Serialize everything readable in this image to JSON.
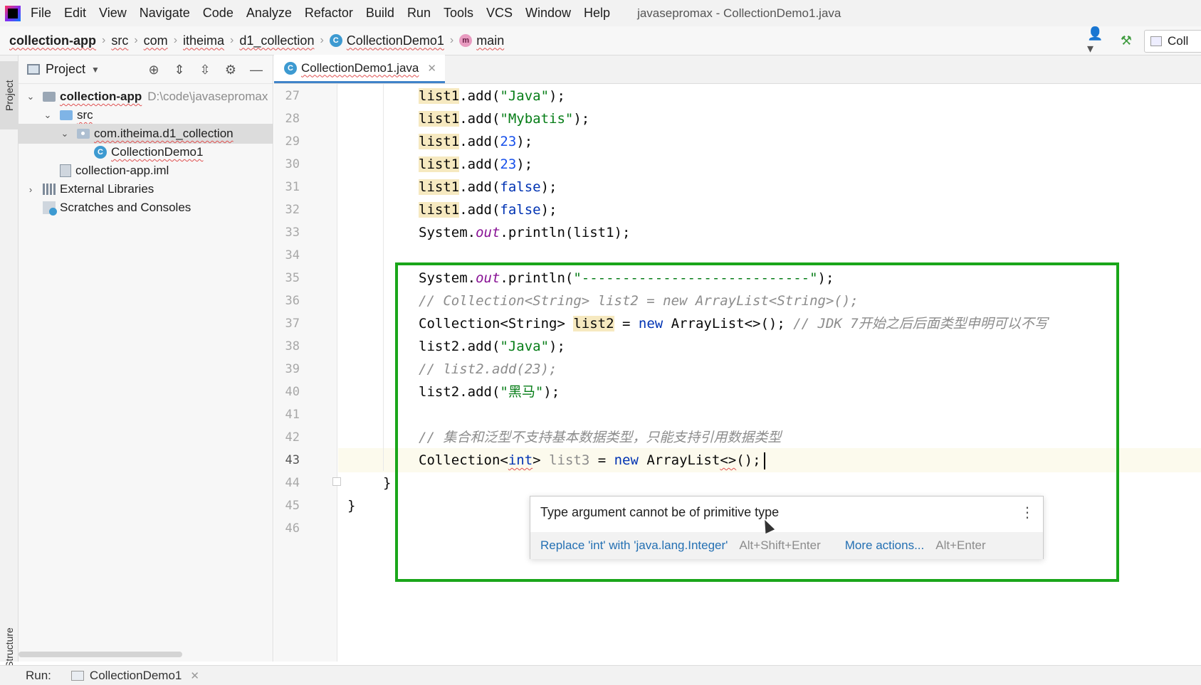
{
  "menubar": {
    "items": [
      "File",
      "Edit",
      "View",
      "Navigate",
      "Code",
      "Analyze",
      "Refactor",
      "Build",
      "Run",
      "Tools",
      "VCS",
      "Window",
      "Help"
    ],
    "window_title": "javasepromax - CollectionDemo1.java"
  },
  "breadcrumbs": [
    "collection-app",
    "src",
    "com",
    "itheima",
    "d1_collection",
    "CollectionDemo1",
    "main"
  ],
  "run_config": {
    "label": "Coll"
  },
  "left_strip": {
    "project_tab": "Project",
    "structure_tab": "Structure"
  },
  "project_panel": {
    "title": "Project",
    "tree": [
      {
        "label": "collection-app",
        "hint": "D:\\code\\javasepromax"
      },
      {
        "label": "src"
      },
      {
        "label": "com.itheima.d1_collection"
      },
      {
        "label": "CollectionDemo1"
      },
      {
        "label": "collection-app.iml"
      },
      {
        "label": "External Libraries"
      },
      {
        "label": "Scratches and Consoles"
      }
    ]
  },
  "editor": {
    "tab_label": "CollectionDemo1.java",
    "line_numbers": [
      "27",
      "28",
      "29",
      "30",
      "31",
      "32",
      "33",
      "34",
      "35",
      "36",
      "37",
      "38",
      "39",
      "40",
      "41",
      "42",
      "43",
      "44",
      "45",
      "46"
    ],
    "code": {
      "l27": {
        "pre": "list1",
        "rest": ".add(",
        "arg": "\"Java\"",
        "end": ");"
      },
      "l28": {
        "pre": "list1",
        "rest": ".add(",
        "arg": "\"Mybatis\"",
        "end": ");"
      },
      "l29": {
        "pre": "list1",
        "rest": ".add(",
        "arg": "23",
        "end": ");"
      },
      "l30": {
        "pre": "list1",
        "rest": ".add(",
        "arg": "23",
        "end": ");"
      },
      "l31": {
        "pre": "list1",
        "rest": ".add(",
        "arg": "false",
        "end": ");"
      },
      "l32": {
        "pre": "list1",
        "rest": ".add(",
        "arg": "false",
        "end": ");"
      },
      "l33": {
        "a": "System.",
        "b": "out",
        "c": ".println(list1);"
      },
      "l35": {
        "a": "System.",
        "b": "out",
        "c": ".println(",
        "d": "\"----------------------------\"",
        "e": ");"
      },
      "l36": "// Collection<String> list2 = new ArrayList<String>();",
      "l37": {
        "a": "Collection<String> ",
        "b": "list2",
        "c": " = ",
        "d": "new",
        "e": " ArrayList<>(); ",
        "f": "// JDK 7开始之后后面类型申明可以不写"
      },
      "l38": {
        "a": "list2.add(",
        "b": "\"Java\"",
        "c": ");"
      },
      "l39": "// list2.add(23);",
      "l40": {
        "a": "list2.add(",
        "b": "\"黑马\"",
        "c": ");"
      },
      "l42": "// 集合和泛型不支持基本数据类型，只能支持引用数据类型",
      "l43": {
        "a": "Collection<",
        "b": "int",
        "c": "> ",
        "d": "list3",
        "e": " = ",
        "f": "new",
        "g": " ArrayList",
        "h": "<>",
        "i": "();"
      },
      "l44": "}",
      "l45": "}"
    }
  },
  "error_popup": {
    "message": "Type argument cannot be of primitive type",
    "fix_label": "Replace 'int' with 'java.lang.Integer'",
    "fix_shortcut": "Alt+Shift+Enter",
    "more_label": "More actions...",
    "more_shortcut": "Alt+Enter"
  },
  "run_bar": {
    "label": "Run:",
    "tab": "CollectionDemo1"
  },
  "colors": {
    "annotation_box": "#1aa61a",
    "string": "#067d17",
    "keyword": "#0033b3",
    "number": "#1750eb",
    "static_field": "#871094",
    "comment": "#8c8c8c",
    "link": "#2470b3"
  }
}
